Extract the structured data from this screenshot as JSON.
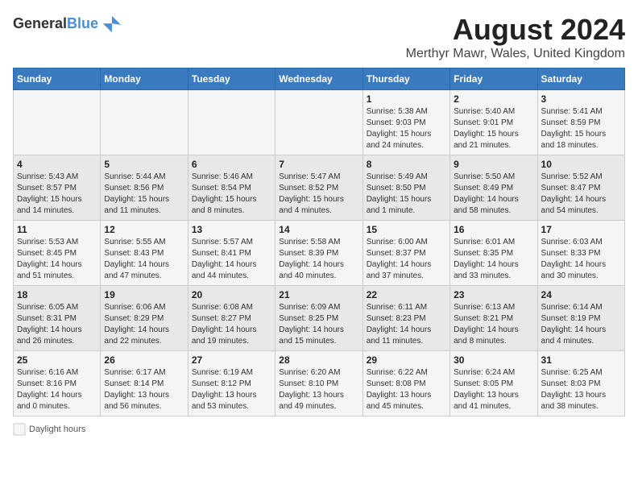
{
  "header": {
    "logo_line1": "General",
    "logo_line2": "Blue",
    "title": "August 2024",
    "subtitle": "Merthyr Mawr, Wales, United Kingdom"
  },
  "columns": [
    "Sunday",
    "Monday",
    "Tuesday",
    "Wednesday",
    "Thursday",
    "Friday",
    "Saturday"
  ],
  "weeks": [
    [
      {
        "day": "",
        "info": ""
      },
      {
        "day": "",
        "info": ""
      },
      {
        "day": "",
        "info": ""
      },
      {
        "day": "",
        "info": ""
      },
      {
        "day": "1",
        "info": "Sunrise: 5:38 AM\nSunset: 9:03 PM\nDaylight: 15 hours and 24 minutes."
      },
      {
        "day": "2",
        "info": "Sunrise: 5:40 AM\nSunset: 9:01 PM\nDaylight: 15 hours and 21 minutes."
      },
      {
        "day": "3",
        "info": "Sunrise: 5:41 AM\nSunset: 8:59 PM\nDaylight: 15 hours and 18 minutes."
      }
    ],
    [
      {
        "day": "4",
        "info": "Sunrise: 5:43 AM\nSunset: 8:57 PM\nDaylight: 15 hours and 14 minutes."
      },
      {
        "day": "5",
        "info": "Sunrise: 5:44 AM\nSunset: 8:56 PM\nDaylight: 15 hours and 11 minutes."
      },
      {
        "day": "6",
        "info": "Sunrise: 5:46 AM\nSunset: 8:54 PM\nDaylight: 15 hours and 8 minutes."
      },
      {
        "day": "7",
        "info": "Sunrise: 5:47 AM\nSunset: 8:52 PM\nDaylight: 15 hours and 4 minutes."
      },
      {
        "day": "8",
        "info": "Sunrise: 5:49 AM\nSunset: 8:50 PM\nDaylight: 15 hours and 1 minute."
      },
      {
        "day": "9",
        "info": "Sunrise: 5:50 AM\nSunset: 8:49 PM\nDaylight: 14 hours and 58 minutes."
      },
      {
        "day": "10",
        "info": "Sunrise: 5:52 AM\nSunset: 8:47 PM\nDaylight: 14 hours and 54 minutes."
      }
    ],
    [
      {
        "day": "11",
        "info": "Sunrise: 5:53 AM\nSunset: 8:45 PM\nDaylight: 14 hours and 51 minutes."
      },
      {
        "day": "12",
        "info": "Sunrise: 5:55 AM\nSunset: 8:43 PM\nDaylight: 14 hours and 47 minutes."
      },
      {
        "day": "13",
        "info": "Sunrise: 5:57 AM\nSunset: 8:41 PM\nDaylight: 14 hours and 44 minutes."
      },
      {
        "day": "14",
        "info": "Sunrise: 5:58 AM\nSunset: 8:39 PM\nDaylight: 14 hours and 40 minutes."
      },
      {
        "day": "15",
        "info": "Sunrise: 6:00 AM\nSunset: 8:37 PM\nDaylight: 14 hours and 37 minutes."
      },
      {
        "day": "16",
        "info": "Sunrise: 6:01 AM\nSunset: 8:35 PM\nDaylight: 14 hours and 33 minutes."
      },
      {
        "day": "17",
        "info": "Sunrise: 6:03 AM\nSunset: 8:33 PM\nDaylight: 14 hours and 30 minutes."
      }
    ],
    [
      {
        "day": "18",
        "info": "Sunrise: 6:05 AM\nSunset: 8:31 PM\nDaylight: 14 hours and 26 minutes."
      },
      {
        "day": "19",
        "info": "Sunrise: 6:06 AM\nSunset: 8:29 PM\nDaylight: 14 hours and 22 minutes."
      },
      {
        "day": "20",
        "info": "Sunrise: 6:08 AM\nSunset: 8:27 PM\nDaylight: 14 hours and 19 minutes."
      },
      {
        "day": "21",
        "info": "Sunrise: 6:09 AM\nSunset: 8:25 PM\nDaylight: 14 hours and 15 minutes."
      },
      {
        "day": "22",
        "info": "Sunrise: 6:11 AM\nSunset: 8:23 PM\nDaylight: 14 hours and 11 minutes."
      },
      {
        "day": "23",
        "info": "Sunrise: 6:13 AM\nSunset: 8:21 PM\nDaylight: 14 hours and 8 minutes."
      },
      {
        "day": "24",
        "info": "Sunrise: 6:14 AM\nSunset: 8:19 PM\nDaylight: 14 hours and 4 minutes."
      }
    ],
    [
      {
        "day": "25",
        "info": "Sunrise: 6:16 AM\nSunset: 8:16 PM\nDaylight: 14 hours and 0 minutes."
      },
      {
        "day": "26",
        "info": "Sunrise: 6:17 AM\nSunset: 8:14 PM\nDaylight: 13 hours and 56 minutes."
      },
      {
        "day": "27",
        "info": "Sunrise: 6:19 AM\nSunset: 8:12 PM\nDaylight: 13 hours and 53 minutes."
      },
      {
        "day": "28",
        "info": "Sunrise: 6:20 AM\nSunset: 8:10 PM\nDaylight: 13 hours and 49 minutes."
      },
      {
        "day": "29",
        "info": "Sunrise: 6:22 AM\nSunset: 8:08 PM\nDaylight: 13 hours and 45 minutes."
      },
      {
        "day": "30",
        "info": "Sunrise: 6:24 AM\nSunset: 8:05 PM\nDaylight: 13 hours and 41 minutes."
      },
      {
        "day": "31",
        "info": "Sunrise: 6:25 AM\nSunset: 8:03 PM\nDaylight: 13 hours and 38 minutes."
      }
    ]
  ],
  "legend": {
    "label": "Daylight hours"
  }
}
